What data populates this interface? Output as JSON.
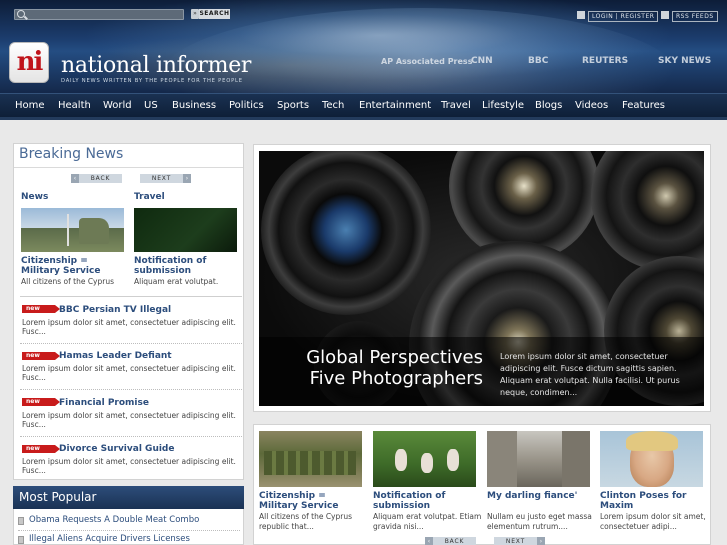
{
  "header": {
    "search_button": "SEARCH",
    "search_arrow": "»",
    "login_label": "LOGIN | REGISTER",
    "rss_label": "RSS FEEDS",
    "logo_text": "ni",
    "site_title": "national informer",
    "tagline": "DAILY NEWS WRITTEN BY THE PEOPLE FOR THE PEOPLE",
    "partners": [
      "AP Associated Press",
      "CNN",
      "BBC",
      "REUTERS",
      "SKY NEWS"
    ]
  },
  "nav": [
    "Home",
    "Health",
    "World",
    "US",
    "Business",
    "Politics",
    "Sports",
    "Tech",
    "Entertainment",
    "Travel",
    "Lifestyle",
    "Blogs",
    "Videos",
    "Features"
  ],
  "breaking": {
    "title": "Breaking News",
    "back_label": "BACK",
    "next_label": "NEXT",
    "prev_arrow": "‹",
    "next_arrow": "›",
    "columns": [
      {
        "heading": "News",
        "title": "Citizenship = Military Service",
        "text": "All citizens of the Cyprus"
      },
      {
        "heading": "Travel",
        "title": "Notification of submission",
        "text": "Aliquam erat volutpat."
      }
    ],
    "badge": "new",
    "list": [
      {
        "title": "BBC Persian TV Illegal",
        "text": "Lorem ipsum dolor sit amet, consectetuer adipiscing elit. Fusc..."
      },
      {
        "title": "Hamas Leader Defiant",
        "text": "Lorem ipsum dolor sit amet, consectetuer adipiscing elit. Fusc..."
      },
      {
        "title": "Financial Promise",
        "text": "Lorem ipsum dolor sit amet, consectetuer adipiscing elit. Fusc..."
      },
      {
        "title": "Divorce Survival Guide",
        "text": "Lorem ipsum dolor sit amet, consectetuer adipiscing elit. Fusc..."
      }
    ]
  },
  "popular": {
    "title": "Most Popular",
    "items": [
      "Obama Requests A Double Meat Combo",
      "Illegal Aliens Acquire Drivers Licenses"
    ]
  },
  "feature": {
    "title": "Global Perspectives Five Photographers",
    "text": "Lorem ipsum dolor sit amet, consectetuer adipiscing elit. Fusce dictum sagittis sapien. Aliquam erat volutpat. Nulla facilisi. Ut purus neque, condimen..."
  },
  "cards": [
    {
      "title": "Citizenship = Military Service",
      "text": "All citizens of the Cyprus republic that..."
    },
    {
      "title": "Notification of submission",
      "text": "Aliquam erat volutpat. Etiam gravida nisi..."
    },
    {
      "title": "My darling fiance'",
      "text": "Nullam eu justo eget massa elementum rutrum...."
    },
    {
      "title": "Clinton Poses for Maxim",
      "text": "Lorem ipsum dolor sit amet, consectetuer adipi..."
    }
  ],
  "cards_nav": {
    "back_label": "BACK",
    "next_label": "NEXT"
  },
  "colors": {
    "brand_red": "#c0141b",
    "nav_dark": "#0e1f37",
    "link_blue": "#2c4d7c",
    "badge_red": "#c81b1b"
  }
}
